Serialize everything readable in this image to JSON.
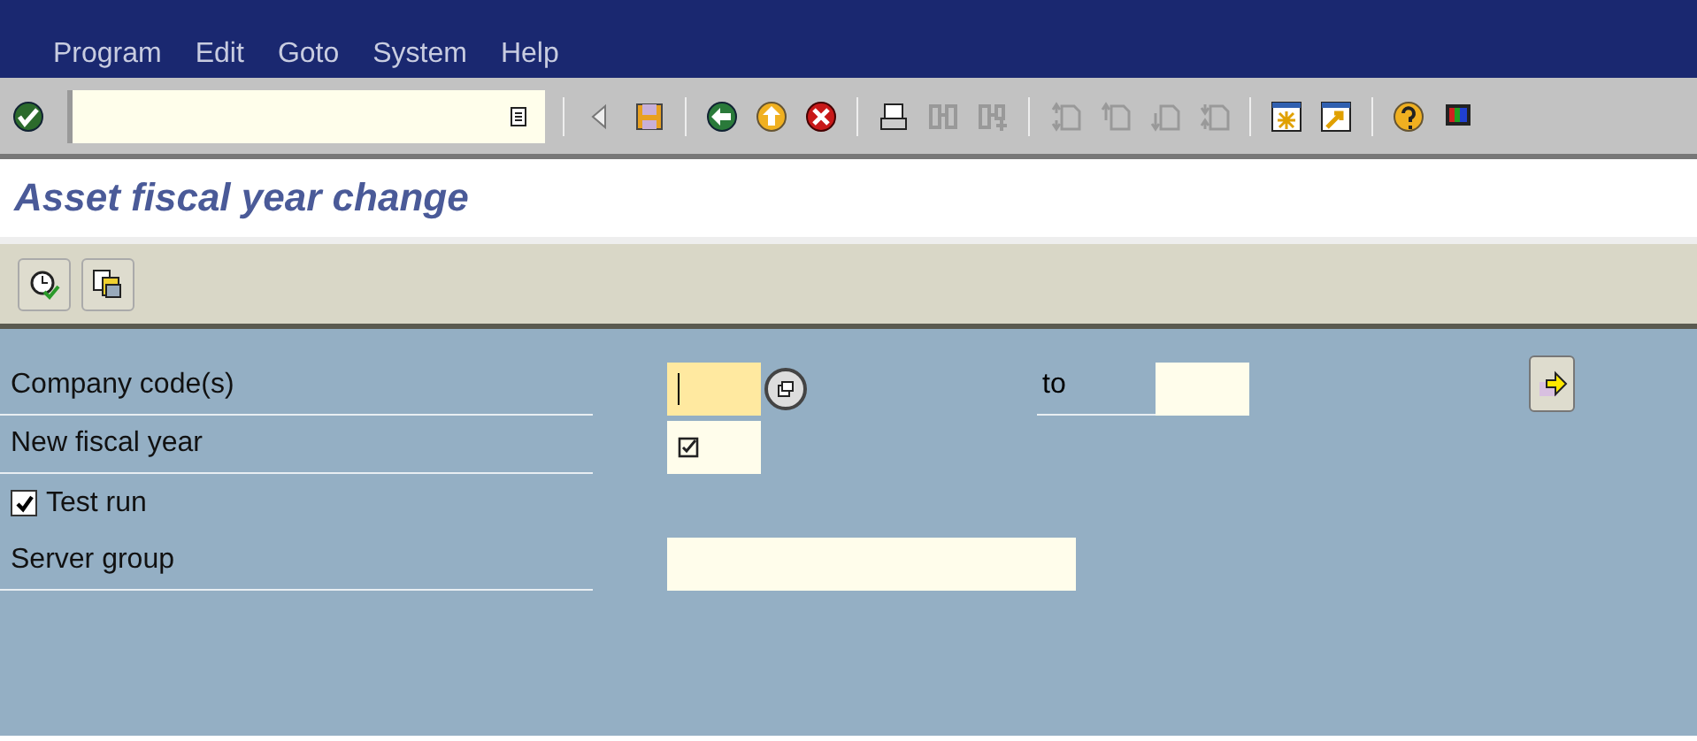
{
  "menu_bar": [
    {
      "label": "Program"
    },
    {
      "label": "Edit"
    },
    {
      "label": "Goto"
    },
    {
      "label": "System"
    },
    {
      "label": "Help"
    }
  ],
  "toolbar": {
    "groups": [
      [
        {
          "kind": "enter",
          "disabled": false
        },
        {
          "kind": "command-field",
          "disabled": false
        }
      ],
      [
        {
          "kind": "collapse",
          "disabled": false
        },
        {
          "kind": "save",
          "disabled": false
        }
      ],
      [
        {
          "kind": "back",
          "disabled": false
        },
        {
          "kind": "exit",
          "disabled": false
        },
        {
          "kind": "cancel",
          "disabled": false
        }
      ],
      [
        {
          "kind": "print",
          "disabled": false
        },
        {
          "kind": "find",
          "disabled": true
        },
        {
          "kind": "find-next",
          "disabled": true
        }
      ],
      [
        {
          "kind": "first-page",
          "disabled": true
        },
        {
          "kind": "previous-page",
          "disabled": true
        },
        {
          "kind": "next-page",
          "disabled": true
        },
        {
          "kind": "last-page",
          "disabled": true
        }
      ],
      [
        {
          "kind": "new-session",
          "disabled": false
        },
        {
          "kind": "shortcut",
          "disabled": false
        }
      ],
      [
        {
          "kind": "help",
          "disabled": false
        },
        {
          "kind": "layout",
          "disabled": false
        }
      ]
    ]
  },
  "title": "Asset fiscal year change",
  "app_toolbar": [
    {
      "kind": "execute"
    },
    {
      "kind": "variants"
    }
  ],
  "form": [
    {
      "kind": "range",
      "label": "Company code(s)",
      "focused": true,
      "to_label": "to"
    },
    {
      "kind": "required",
      "label": "New fiscal year",
      "focused": false
    },
    {
      "kind": "checkbox",
      "label": "Test run",
      "checked": true
    },
    {
      "kind": "text",
      "label": "Server group",
      "focused": false
    }
  ]
}
